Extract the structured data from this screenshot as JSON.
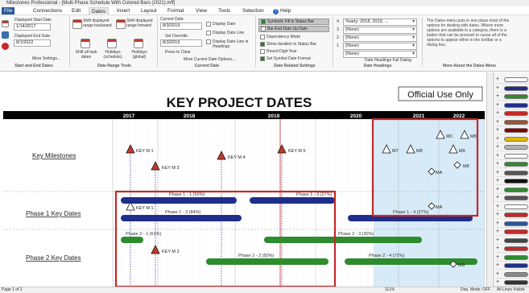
{
  "window": {
    "title": "Milestones Professional - [Multi Phase Schedule With Colored Bars (2021).mff]"
  },
  "menu": {
    "items": [
      "File",
      "Connections",
      "Edit",
      "Dates",
      "Insert",
      "Layout",
      "Format",
      "View",
      "Tools",
      "Selection"
    ],
    "help": "Help"
  },
  "ribbon": {
    "start_end": {
      "displayed_start_label": "Displayed Start Date",
      "displayed_start_value": "1/14/2017",
      "displayed_end_label": "Displayed End Date",
      "displayed_end_value": "8/1/2022",
      "more_settings": "More Settings...",
      "group_label": "Start and End Dates"
    },
    "range_tools": {
      "shift_back": "Shift displayed range backward",
      "shift_forward": "Shift displayed range forward",
      "shift_all": "Shift all task dates",
      "holidays_schedule": "Holidays (schedule)",
      "holidays_global": "Holidays (global)",
      "group_label": "Date Range Tools"
    },
    "current": {
      "current_date_label": "Current Date",
      "current_date_value": "8/3/2019",
      "set_override": "Set Override",
      "override_value": "8/3/2019",
      "press_to_clear": "Press to Clear",
      "display_date": "Display Date",
      "display_date_line": "Display Date Line",
      "display_date_line_in_headings": "Display Date Line in Headings",
      "more_dialog": "More Current Date Options...",
      "group_label": "Current Date"
    },
    "related": {
      "symbolic": "Symbolic Fill in Status Bar",
      "bar_end": "Bar End Date Up Date",
      "dependency": "Dependency Mode",
      "show_duration": "Show duration in Status Bar",
      "round_digit": "Round Digit Year",
      "set_symbol": "Set Symbol Date Format",
      "group_label": "Date Related Settings"
    },
    "headings": {
      "rows": [
        {
          "num": "4",
          "value": "Yearly: 2018, 2019, ..."
        },
        {
          "num": "3",
          "value": "(None)"
        },
        {
          "num": "2",
          "value": "(None)"
        },
        {
          "num": "1",
          "value": "(None)"
        },
        {
          "num": "",
          "value": "(None)"
        }
      ],
      "full_dialog": "Date Headings Full Dialog",
      "group_label": "Date Headings"
    },
    "about": {
      "text": "The Dates menu puts in one place most of the options for dealing with dates. Where more options are available in a category, there is a button that can be pressed to cause all of the options to appear either in the toolbar or a dialog box.",
      "group_label": "More About the Dates Menu"
    }
  },
  "chart": {
    "title": "KEY PROJECT DATES",
    "official": "Official Use Only",
    "years": [
      "2017",
      "2018",
      "2019",
      "2020",
      "2021",
      "2022"
    ],
    "rows": [
      "Key Milestones",
      "Phase 1 Key Dates",
      "Phase 2 Key Dates"
    ]
  },
  "chart_data": {
    "type": "gantt",
    "title": "KEY PROJECT DATES",
    "x_axis": [
      "2017",
      "2018",
      "2019",
      "2020",
      "2021",
      "2022"
    ],
    "milestones": [
      {
        "label": "KEY M 1",
        "row": "Key Milestones",
        "color": "#c0392b",
        "shape": "triangle"
      },
      {
        "label": "KEY M 3",
        "row": "Key Milestones",
        "color": "#c0392b",
        "shape": "triangle"
      },
      {
        "label": "KEY M 4",
        "row": "Key Milestones",
        "color": "#c0392b",
        "shape": "triangle"
      },
      {
        "label": "KEY M 5",
        "row": "Key Milestones",
        "color": "#c0392b",
        "shape": "triangle"
      },
      {
        "label": "M7",
        "row": "Key Milestones",
        "color": "#ffffff",
        "shape": "triangle"
      },
      {
        "label": "M8",
        "row": "Key Milestones",
        "color": "#ffffff",
        "shape": "triangle"
      },
      {
        "label": "MC",
        "row": "Key Milestones",
        "color": "#ffffff",
        "shape": "triangle"
      },
      {
        "label": "M8",
        "row": "Key Milestones",
        "color": "#ffffff",
        "shape": "triangle"
      },
      {
        "label": "M9",
        "row": "Key Milestones",
        "color": "#ffffff",
        "shape": "triangle"
      },
      {
        "label": "M8",
        "row": "Key Milestones",
        "color": "#ffffff",
        "shape": "diamond"
      },
      {
        "label": "MA",
        "row": "Key Milestones",
        "color": "#ffffff",
        "shape": "diamond"
      },
      {
        "label": "KEY M 1",
        "row": "Phase 1 Key Dates",
        "color": "#ffffff",
        "shape": "triangle"
      },
      {
        "label": "MA",
        "row": "Phase 1 Key Dates",
        "color": "#ffffff",
        "shape": "diamond"
      },
      {
        "label": "KEY M 3",
        "row": "Phase 2 Key Dates",
        "color": "#c0392b",
        "shape": "triangle"
      },
      {
        "label": "MB",
        "row": "Phase 2 Key Dates",
        "color": "#ffffff",
        "shape": "diamond"
      }
    ],
    "bars": [
      {
        "label": "Phase 1 - 1 (50%)",
        "row": "Phase 1 Key Dates",
        "color": "#1f2e8a"
      },
      {
        "label": "Phase 1 - 2 (84%)",
        "row": "Phase 1 Key Dates",
        "color": "#1f2e8a"
      },
      {
        "label": "Phase 1 - 3 (27%)",
        "row": "Phase 1 Key Dates",
        "color": "#1f2e8a"
      },
      {
        "label": "Phase 1 - 4 (27%)",
        "row": "Phase 1 Key Dates",
        "color": "#1f2e8a"
      },
      {
        "label": "Phase 2 - 1 (61%)",
        "row": "Phase 2 Key Dates",
        "color": "#2e8b2e"
      },
      {
        "label": "Phase 2 - 2 (50%)",
        "row": "Phase 2 Key Dates",
        "color": "#2e8b2e"
      },
      {
        "label": "Phase 2 - 3 (30%)",
        "row": "Phase 2 Key Dates",
        "color": "#2e8b2e"
      },
      {
        "label": "Phase 2 - 4 (72%)",
        "row": "Phase 2 Key Dates",
        "color": "#2e8b2e"
      }
    ]
  },
  "status": {
    "page": "Page 1 of 2",
    "zoom": "111%",
    "dep_mode": "Dep. Mode: OFF",
    "all_lines": "All Lines Visible"
  },
  "colors": {
    "milestone_red": "#c0392b",
    "phase1_blue": "#1f2e8a",
    "phase2_green": "#2e8b2e",
    "highlight_red": "#c62828",
    "shade_blue": "#d6eaf8"
  }
}
